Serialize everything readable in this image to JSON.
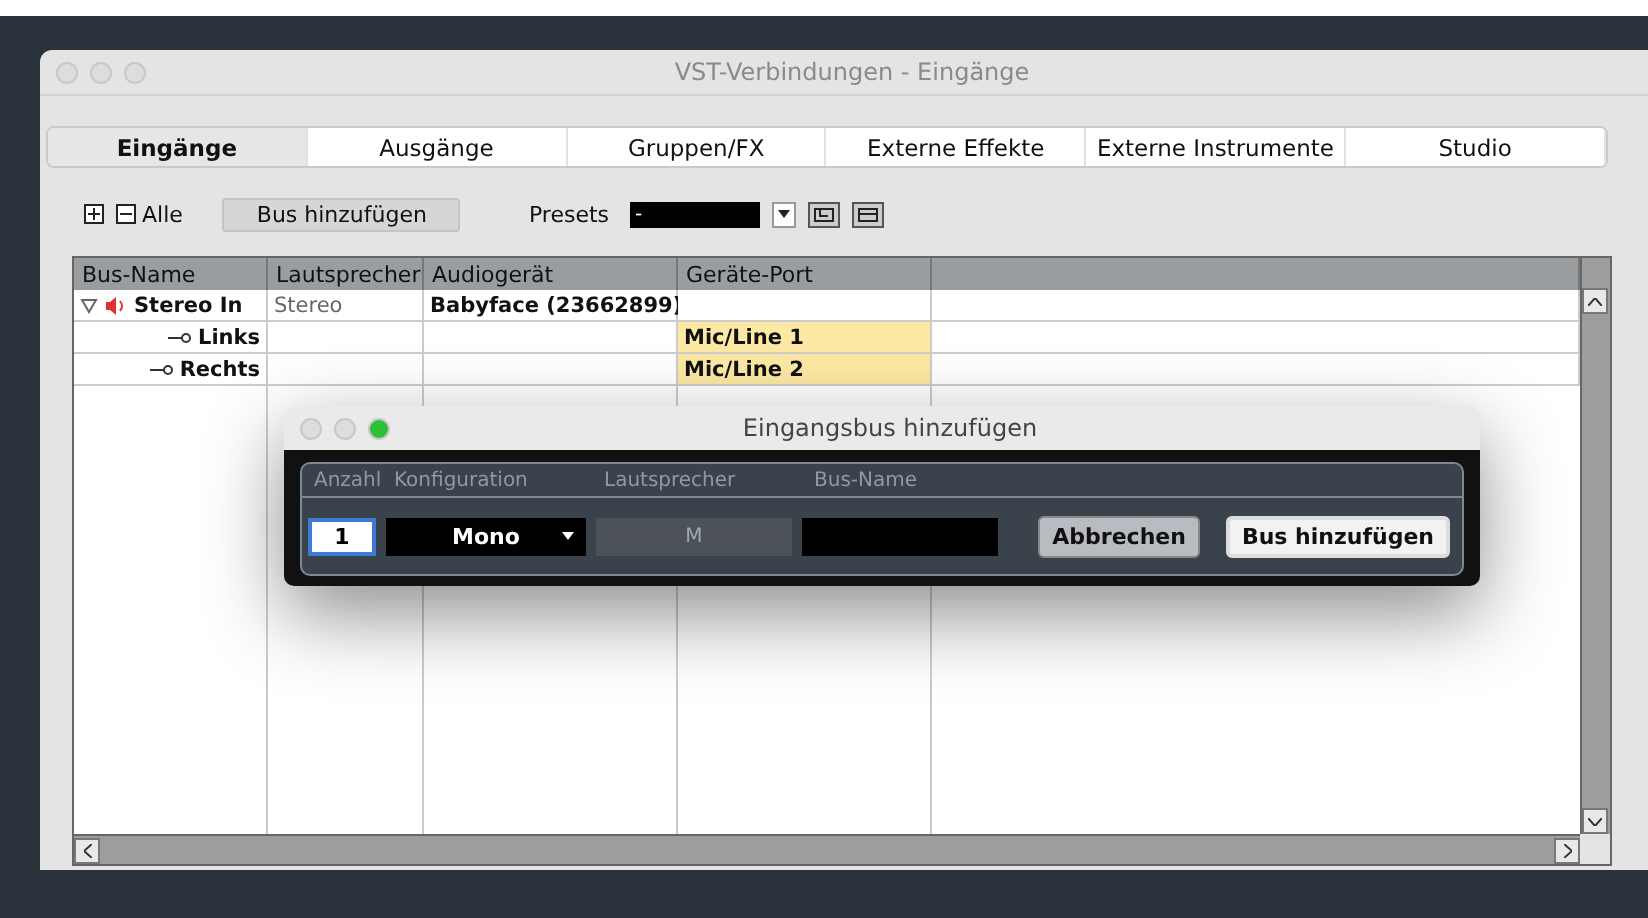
{
  "window": {
    "title": "VST-Verbindungen - Eingänge"
  },
  "tabs": [
    {
      "label": "Eingänge",
      "selected": true
    },
    {
      "label": "Ausgänge",
      "selected": false
    },
    {
      "label": "Gruppen/FX",
      "selected": false
    },
    {
      "label": "Externe Effekte",
      "selected": false
    },
    {
      "label": "Externe Instrumente",
      "selected": false
    },
    {
      "label": "Studio",
      "selected": false
    }
  ],
  "toolbar": {
    "all_label": "Alle",
    "add_bus_button": "Bus hinzufügen",
    "presets_label": "Presets",
    "preset_value": "-"
  },
  "table": {
    "columns": [
      "Bus-Name",
      "Lautsprecher",
      "Audiogerät",
      "Geräte-Port"
    ],
    "rows": [
      {
        "name": "Stereo In",
        "speaker": "Stereo",
        "device": "Babyface (23662899)",
        "expanded": true,
        "children": [
          {
            "name": "Links",
            "port": "Mic/Line 1"
          },
          {
            "name": "Rechts",
            "port": "Mic/Line 2"
          }
        ]
      }
    ]
  },
  "dialog": {
    "title": "Eingangsbus hinzufügen",
    "columns": [
      "Anzahl",
      "Konfiguration",
      "Lautsprecher",
      "Bus-Name"
    ],
    "count": "1",
    "configuration": "Mono",
    "speaker": "M",
    "speaker_disabled": true,
    "buttons": [
      {
        "label": "Abbrechen",
        "default": false
      },
      {
        "label": "Bus hinzufügen",
        "default": true
      }
    ]
  }
}
